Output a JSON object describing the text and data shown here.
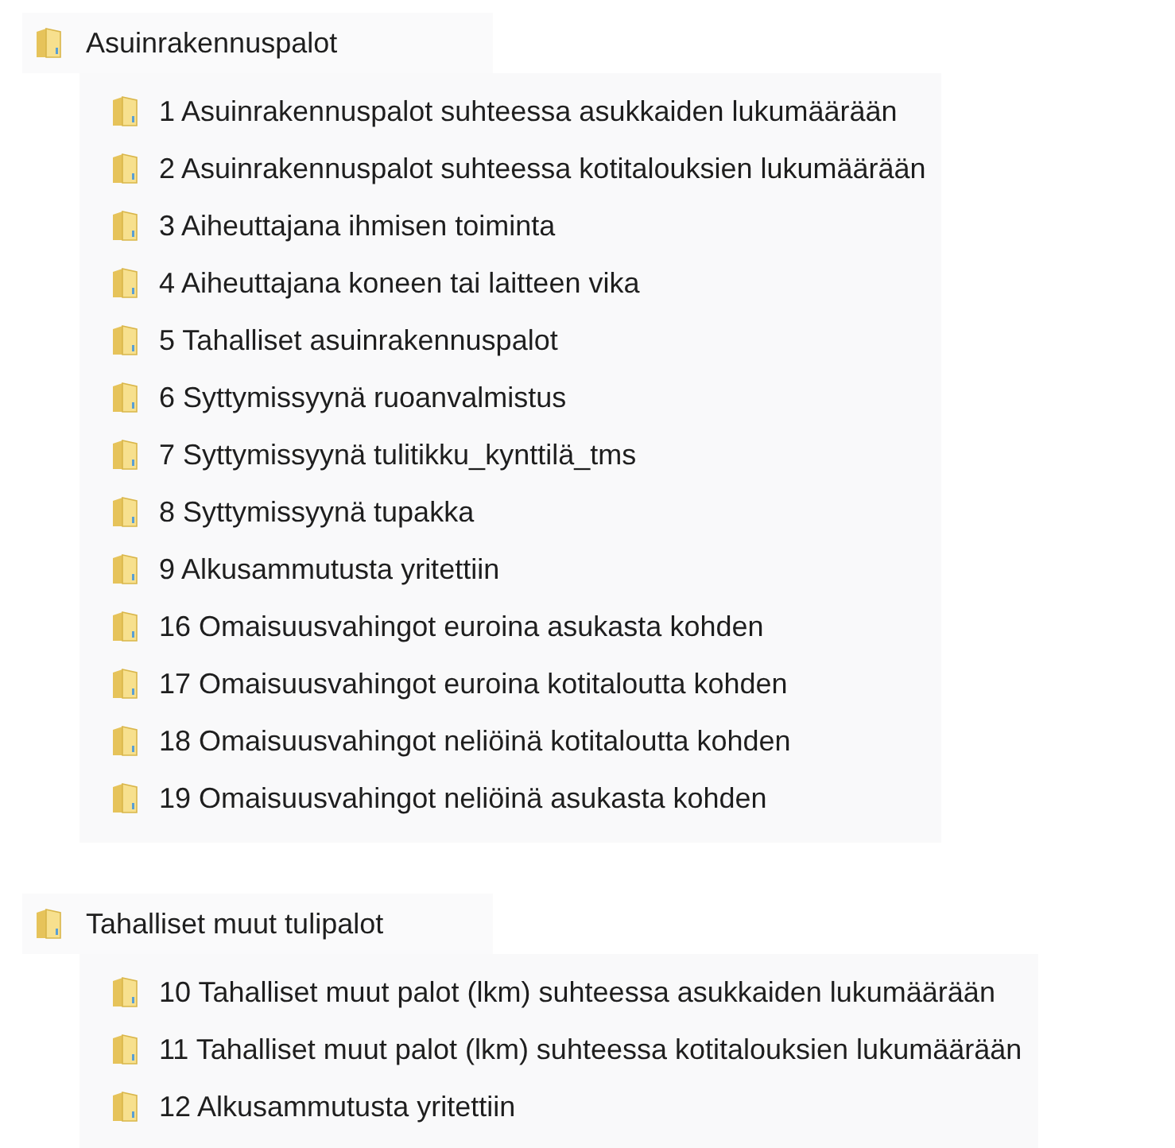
{
  "groups": [
    {
      "name": "Asuinrakennuspalot",
      "children": [
        "1 Asuinrakennuspalot suhteessa asukkaiden lukumäärään",
        "2 Asuinrakennuspalot suhteessa kotitalouksien lukumäärään",
        "3 Aiheuttajana ihmisen toiminta",
        "4 Aiheuttajana koneen tai laitteen vika",
        "5 Tahalliset asuinrakennuspalot",
        "6 Syttymissyynä ruoanvalmistus",
        "7 Syttymissyynä tulitikku_kynttilä_tms",
        "8 Syttymissyynä tupakka",
        "9 Alkusammutusta yritettiin",
        "16 Omaisuusvahingot euroina asukasta kohden",
        "17 Omaisuusvahingot euroina kotitaloutta kohden",
        "18 Omaisuusvahingot neliöinä kotitaloutta kohden",
        "19 Omaisuusvahingot neliöinä asukasta kohden"
      ]
    },
    {
      "name": "Tahalliset muut tulipalot",
      "children": [
        "10 Tahalliset muut palot (lkm) suhteessa asukkaiden lukumäärään",
        "11 Tahalliset muut palot (lkm) suhteessa kotitalouksien lukumäärään",
        "12 Alkusammutusta yritettiin"
      ]
    }
  ]
}
